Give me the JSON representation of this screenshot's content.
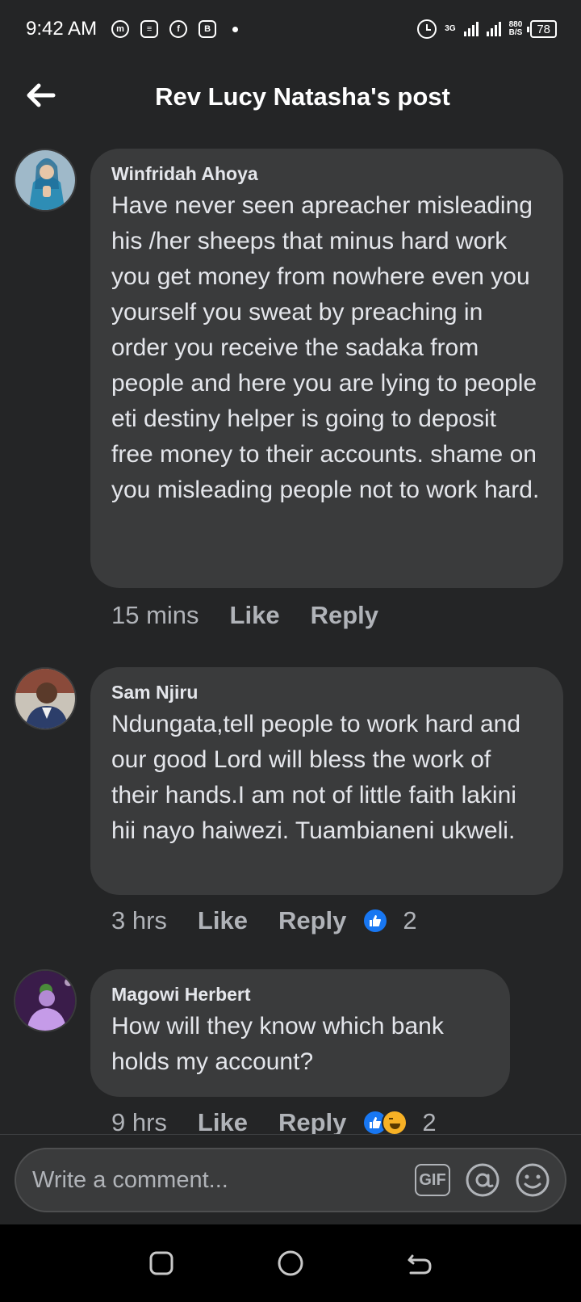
{
  "status_bar": {
    "time": "9:42 AM",
    "icons": [
      "messenger-icon",
      "news-icon",
      "facebook-icon",
      "browser-icon"
    ],
    "network": "3G",
    "speed_value": "880",
    "speed_unit": "B/S",
    "battery": "78"
  },
  "header": {
    "title": "Rev Lucy Natasha's post"
  },
  "comments": [
    {
      "author": "Winfridah Ahoya",
      "text": "Have never seen apreacher misleading his /her sheeps that minus hard work you get money from nowhere even you yourself you sweat by preaching in order you receive the sadaka from people and here you are lying to people eti destiny helper is going to deposit free money to their accounts. shame on you misleading people not to work hard.",
      "time": "15 mins",
      "like_label": "Like",
      "reply_label": "Reply"
    },
    {
      "author": "Sam Njiru",
      "text": "Ndungata,tell people to work hard and our good Lord will bless the work of their hands.I am not of little faith lakini hii nayo haiwezi. Tuambianeni ukweli.",
      "time": "3 hrs",
      "like_label": "Like",
      "reply_label": "Reply",
      "reaction_count": "2"
    },
    {
      "author": "Magowi Herbert",
      "text": "How will they know which bank holds my account?",
      "time": "9 hrs",
      "like_label": "Like",
      "reply_label": "Reply",
      "reaction_count": "2"
    }
  ],
  "composer": {
    "placeholder": "Write a comment...",
    "gif_label": "GIF"
  },
  "colors": {
    "background": "#242526",
    "bubble": "#3a3b3c",
    "text": "#e4e6eb",
    "secondary_text": "#b0b3b8",
    "like_blue": "#1877f2",
    "haha_yellow": "#f7b125"
  }
}
